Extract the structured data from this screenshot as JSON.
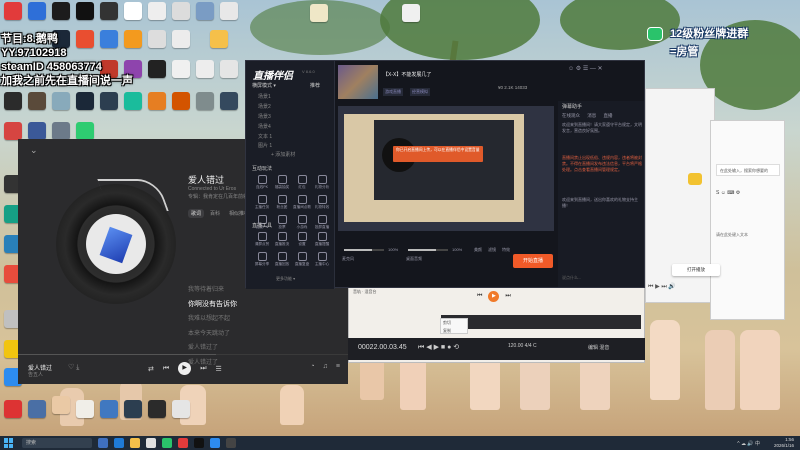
{
  "overlay": {
    "lines": [
      "节目:8.鹅鸭",
      "YY.97102918",
      "steamID 458063774",
      "加我之前先在直播间说一声"
    ]
  },
  "wechat_badge": {
    "line1": "12级粉丝牌进群",
    "line2": "=房管"
  },
  "desktop_icon_labels": [
    "",
    "",
    "",
    "",
    ""
  ],
  "music_player": {
    "song_title": "爱人错过",
    "song_subtitle": "Connected to Ur Eros",
    "album": "专辑：我肯定在几百年前就说过爱你",
    "tabs": [
      "歌词",
      "百科",
      "相似推荐"
    ],
    "lyrics": [
      "",
      "",
      "",
      "",
      "我等待着归来",
      "你啊没有告诉你",
      "我难以想起不起",
      "本来今天跳动了",
      "爱人错过了",
      "爱人错过了"
    ],
    "current_lyric_index": 5,
    "now_playing_title": "爱人错过",
    "now_playing_artist": "告五人",
    "time_text": "",
    "progress": 0.6,
    "icons": {
      "collapse": "chevron-down-icon",
      "play": "play-icon"
    }
  },
  "live_studio": {
    "logo": "直播伴侣",
    "version": "V 8.6.0",
    "mode_label": "横屏模式 ▾",
    "mode_right": "推荐",
    "scenes": [
      "场景1",
      "场景2",
      "场景3",
      "场景4",
      "文本 1",
      "图片 1"
    ],
    "add_material": "+ 添加素材",
    "section_interactive": "互动玩法",
    "section_tools": "直播工具",
    "interactive_tools": [
      "连线PK",
      "福袋抽奖",
      "红包",
      "礼物分析",
      "主播任务",
      "粉丝团",
      "直播间点歌",
      "礼物特效",
      "连麦PK",
      "投票",
      "小游戏",
      "投屏直播"
    ],
    "live_tools": [
      "清屏点赞",
      "直播推流",
      "设置",
      "直播提醒",
      "屏幕分享",
      "直播回放",
      "直播复盘",
      "主播中心"
    ],
    "more": "更多功能 ▾",
    "room_name": "【X-X】不能发展几了",
    "tags": [
      "游戏直播",
      "经营模拟"
    ],
    "stats": "¥0  2.1K  14033",
    "preview_toast": "你已开启直播间上传，可以在直播伴侣中设置音量",
    "audio": {
      "mic_label": "麦克风",
      "mic_pct": "100%",
      "desk_label": "桌面音频",
      "desk_pct": "100%",
      "mic_level": 0.7,
      "desk_level": 0.7
    },
    "extra_controls": [
      "美颜",
      "滤镜",
      "特效",
      "更多"
    ],
    "start_button": "开始直播",
    "assistant": {
      "title": "弹幕助手",
      "tabs": [
        "在线观众",
        "消息",
        "直播"
      ],
      "message": "欢迎来到直播间！请大家遵守平台规定，文明发言，营造良好氛围。",
      "warning": "直播间禁止出现低俗、违规内容，违者将被封禁。不得在直播间发布违法信息，平台将严格处理。点击查看直播间管理规定。",
      "tip": "欢迎来到直播间，送出你喜欢的礼物支持主播！",
      "input_placeholder": "说点什么..."
    }
  },
  "chat_window": {
    "search_text": "在此处输入，搜索你想要的",
    "toolbar": "S  ☺  ⌨  ⚙",
    "note": "请在此处键入文本"
  },
  "pill": "打开播放",
  "editor": {
    "top_label": "音轨 · 混音台",
    "timecode": "00022.00.03.45",
    "tempo": "120.00  4/4  C",
    "right_label": "编辑  混音",
    "menu_items": [
      "剪切",
      "复制"
    ]
  },
  "taskbar": {
    "search_placeholder": "搜索",
    "clock_time": "1:56",
    "clock_date": "2026/1/16",
    "tray": "^ ☁ 🔊 中"
  }
}
